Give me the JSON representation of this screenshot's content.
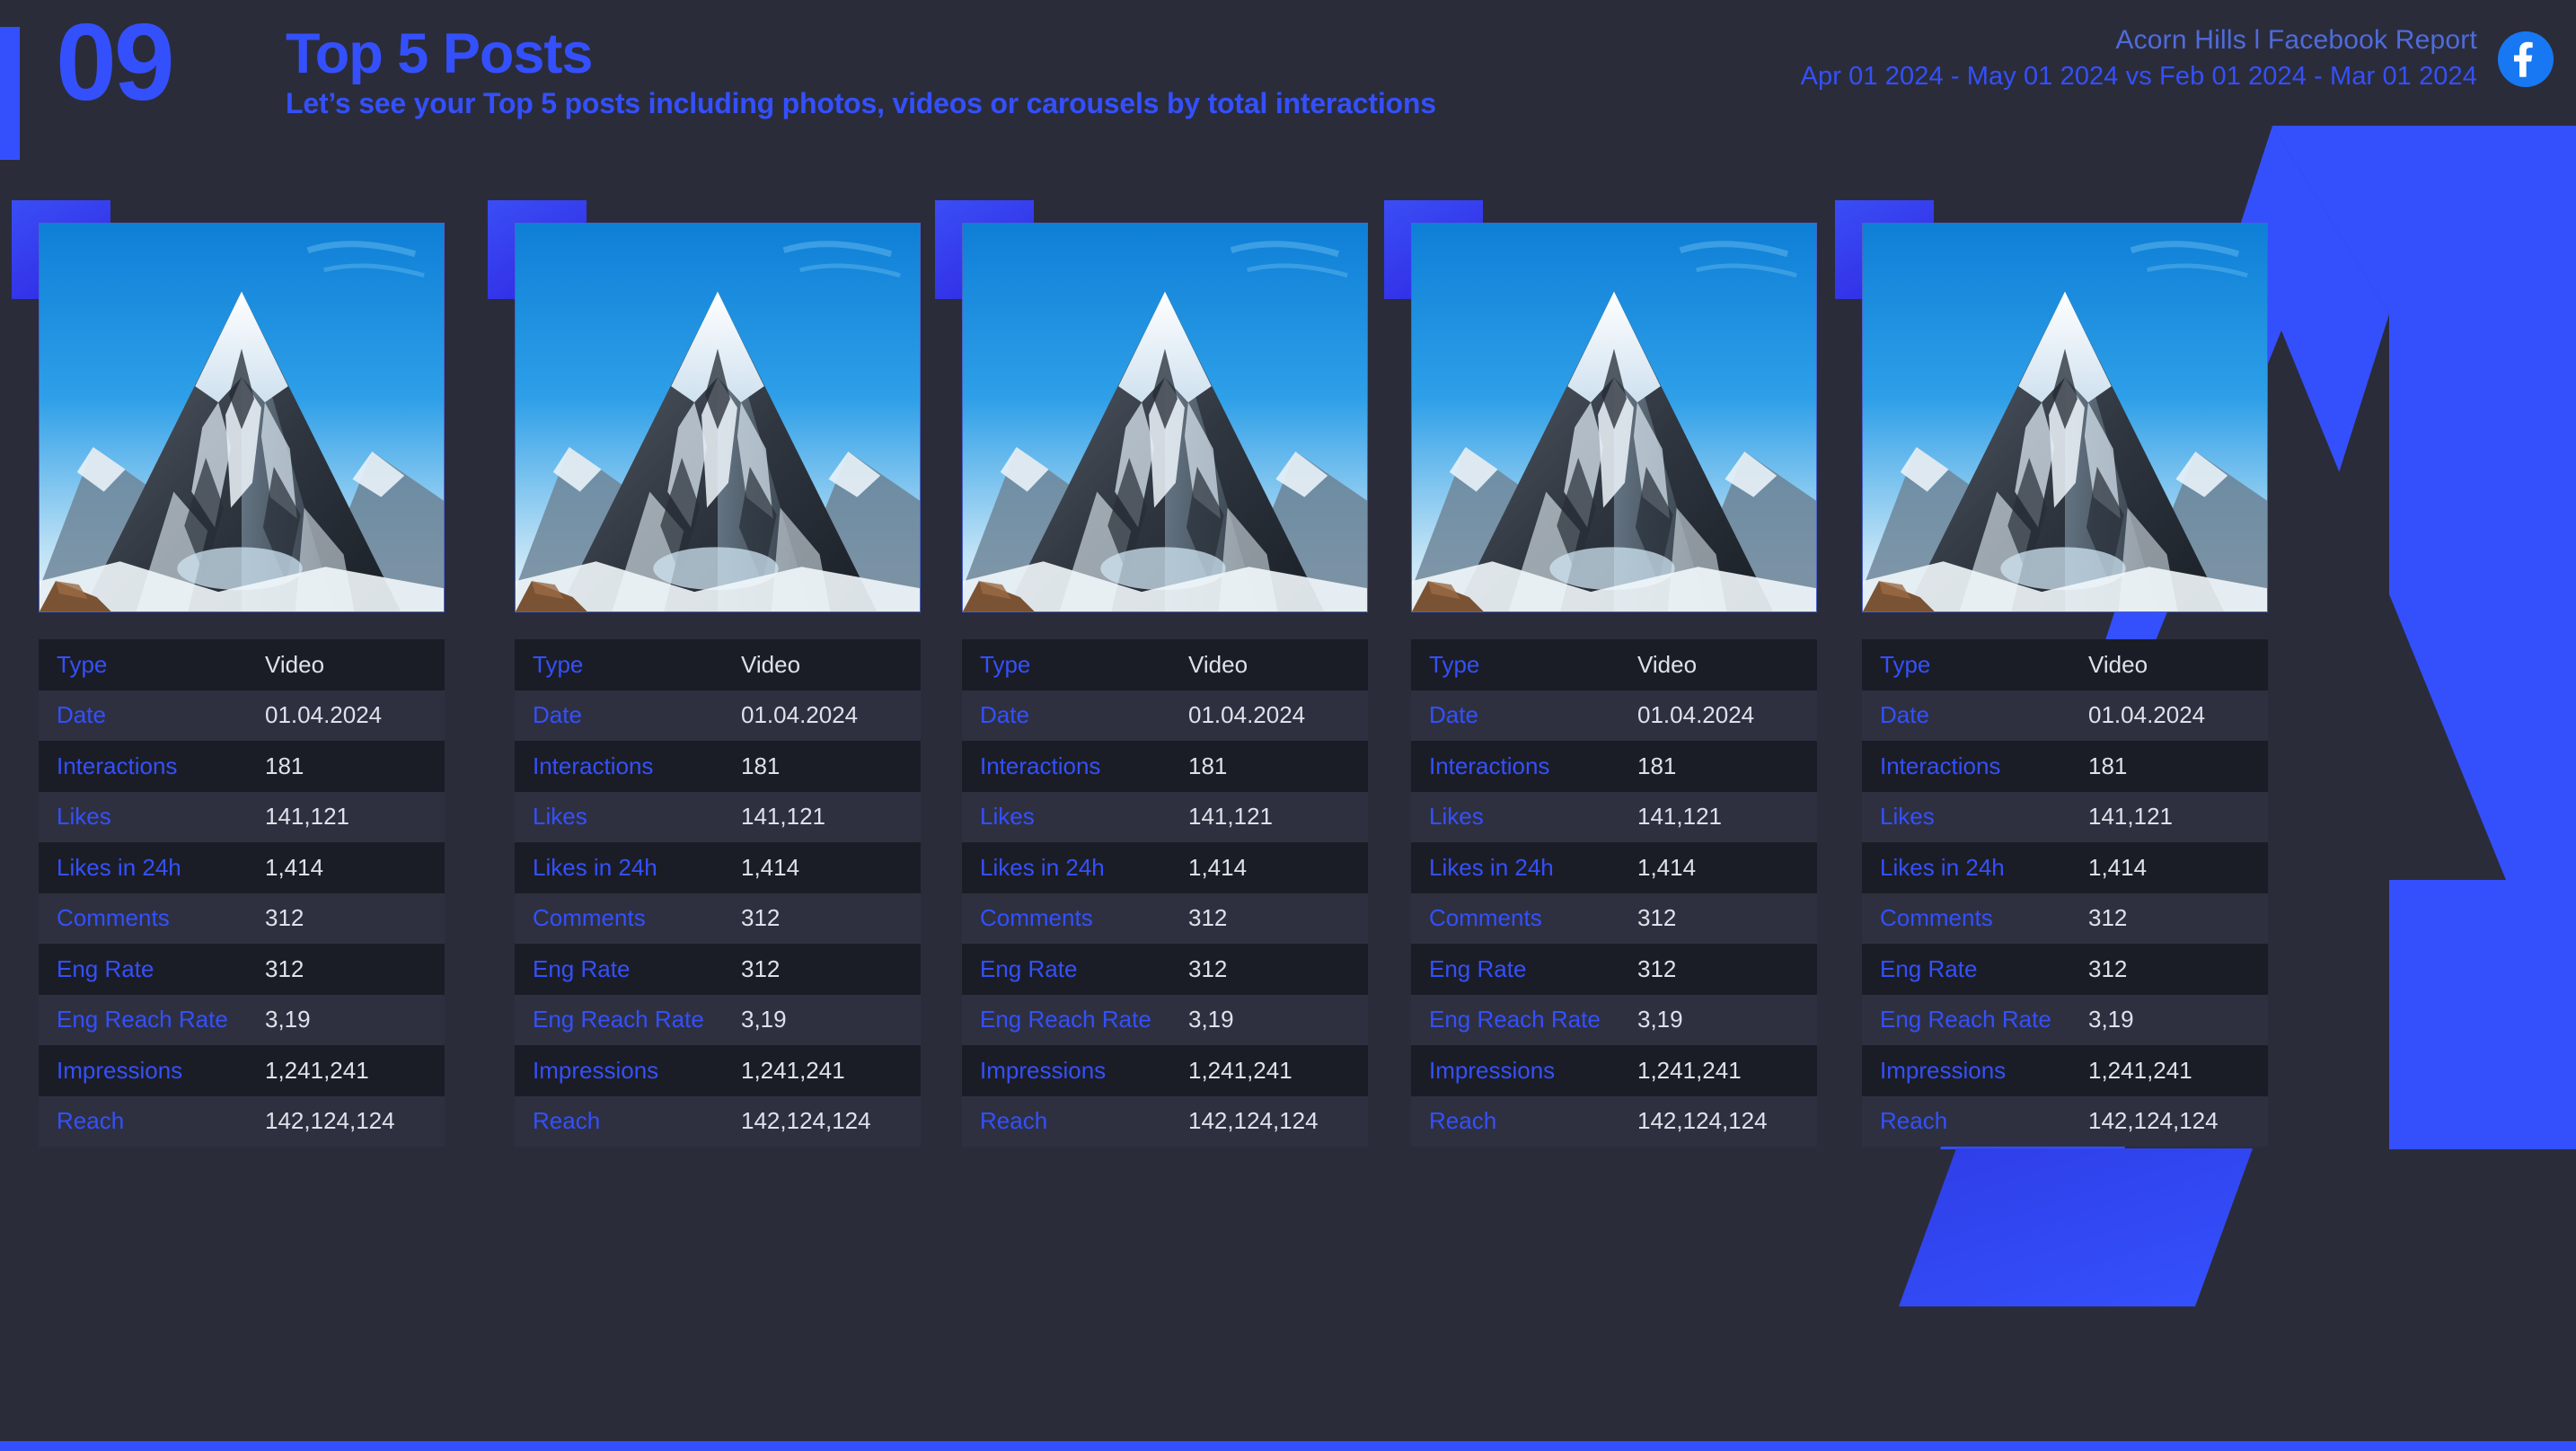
{
  "header": {
    "step_number": "09",
    "title": "Top 5 Posts",
    "subtitle": "Let’s see your Top 5 posts including photos, videos or carousels by total interactions",
    "brand_line": "Acorn Hills  l Facebook Report",
    "date_range": "Apr 01 2024 - May 01 2024 vs Feb 01 2024 - Mar 01 2024",
    "platform_icon": "facebook-icon"
  },
  "colors": {
    "accent_blue": "#3450fc",
    "background": "#2b2c3a",
    "row_dark": "#1b1d26",
    "row_light": "#2e3040",
    "value_text": "#dfe1ea",
    "brand_text": "#4f6bdc",
    "facebook_blue": "#1877f2"
  },
  "table_labels": [
    "Type",
    "Date",
    "Interactions",
    "Likes",
    "Likes in 24h",
    "Comments",
    "Eng Rate",
    "Eng Reach Rate",
    "Impressions",
    "Reach"
  ],
  "cards": [
    {
      "thumbnail": "mountain-photo",
      "values": [
        "Video",
        "01.04.2024",
        "181",
        "141,121",
        "1,414",
        "312",
        "312",
        "3,19",
        "1,241,241",
        "142,124,124"
      ]
    },
    {
      "thumbnail": "mountain-photo",
      "values": [
        "Video",
        "01.04.2024",
        "181",
        "141,121",
        "1,414",
        "312",
        "312",
        "3,19",
        "1,241,241",
        "142,124,124"
      ]
    },
    {
      "thumbnail": "mountain-photo",
      "values": [
        "Video",
        "01.04.2024",
        "181",
        "141,121",
        "1,414",
        "312",
        "312",
        "3,19",
        "1,241,241",
        "142,124,124"
      ]
    },
    {
      "thumbnail": "mountain-photo",
      "values": [
        "Video",
        "01.04.2024",
        "181",
        "141,121",
        "1,414",
        "312",
        "312",
        "3,19",
        "1,241,241",
        "142,124,124"
      ]
    },
    {
      "thumbnail": "mountain-photo",
      "values": [
        "Video",
        "01.04.2024",
        "181",
        "141,121",
        "1,414",
        "312",
        "312",
        "3,19",
        "1,241,241",
        "142,124,124"
      ]
    }
  ]
}
